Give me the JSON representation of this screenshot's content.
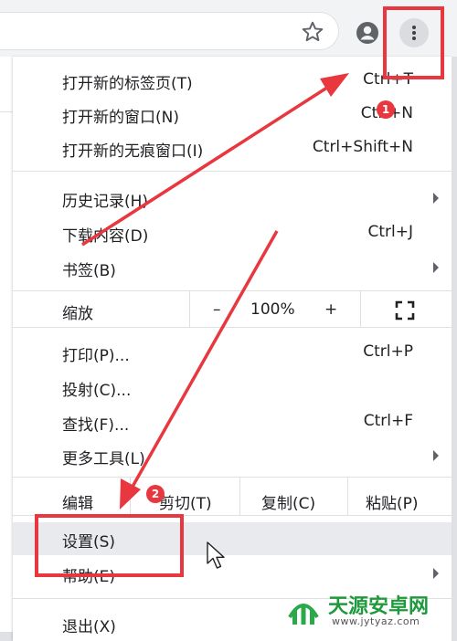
{
  "menu": {
    "new_tab": {
      "label": "打开新的标签页(T)",
      "shortcut": "Ctrl+T"
    },
    "new_window": {
      "label": "打开新的窗口(N)",
      "shortcut": "Ctrl+N"
    },
    "new_incognito": {
      "label": "打开新的无痕窗口(I)",
      "shortcut": "Ctrl+Shift+N"
    },
    "history": {
      "label": "历史记录(H)"
    },
    "downloads": {
      "label": "下载内容(D)",
      "shortcut": "Ctrl+J"
    },
    "bookmarks": {
      "label": "书签(B)"
    },
    "zoom": {
      "label": "缩放",
      "minus": "–",
      "value": "100%",
      "plus": "+"
    },
    "print": {
      "label": "打印(P)...",
      "shortcut": "Ctrl+P"
    },
    "cast": {
      "label": "投射(C)..."
    },
    "find": {
      "label": "查找(F)...",
      "shortcut": "Ctrl+F"
    },
    "more_tools": {
      "label": "更多工具(L)"
    },
    "edit": {
      "label": "编辑",
      "cut": "剪切(T)",
      "copy": "复制(C)",
      "paste": "粘贴(P)"
    },
    "settings": {
      "label": "设置(S)"
    },
    "help": {
      "label": "帮助(E)"
    },
    "exit": {
      "label": "退出(X)"
    }
  },
  "annotations": {
    "step1": "1",
    "step2": "2",
    "color": "#e8373e"
  },
  "watermark": {
    "name": "天源安卓网",
    "url": "www.jytyaz.com"
  }
}
